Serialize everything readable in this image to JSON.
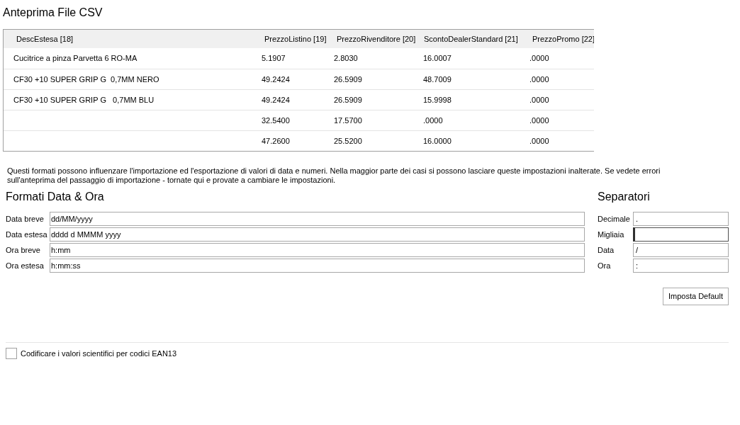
{
  "title": "Anteprima File CSV",
  "table": {
    "columns": [
      "DescEstesa [18]",
      "PrezzoListino [19]",
      "PrezzoRivenditore [20]",
      "ScontoDealerStandard [21]",
      "PrezzoPromo [22]"
    ],
    "rows": [
      [
        "Cucitrice a pinza Parvetta 6 RO-MA",
        "5.1907",
        "2.8030",
        "16.0007",
        ".0000"
      ],
      [
        "CF30 +10 SUPER GRIP G  0,7MM NERO",
        "49.2424",
        "26.5909",
        "48.7009",
        ".0000"
      ],
      [
        "CF30 +10 SUPER GRIP G   0,7MM BLU",
        "49.2424",
        "26.5909",
        "15.9998",
        ".0000"
      ],
      [
        "",
        "32.5400",
        "17.5700",
        ".0000",
        ".0000"
      ],
      [
        "",
        "47.2600",
        "25.5200",
        "16.0000",
        ".0000"
      ]
    ]
  },
  "info": "Questi formati possono influenzare l'importazione ed l'esportazione di valori di data e numeri. Nella maggior parte dei casi si possono lasciare queste impostazioni inalterate. Se vedete errori sull'anteprima del passaggio di importazione - tornate qui e provate a cambiare le impostazioni.",
  "date_formats": {
    "heading": "Formati Data & Ora",
    "fields": [
      {
        "label": "Data breve",
        "value": "dd/MM/yyyy"
      },
      {
        "label": "Data estesa",
        "value": "dddd d MMMM yyyy"
      },
      {
        "label": "Ora breve",
        "value": "h:mm"
      },
      {
        "label": "Ora estesa",
        "value": "h:mm:ss"
      }
    ]
  },
  "separators": {
    "heading": "Separatori",
    "fields": [
      {
        "label": "Decimale",
        "value": ".",
        "focused": false
      },
      {
        "label": "Migliaia",
        "focused": true
      },
      {
        "label": "Data",
        "value": "/",
        "focused": false
      },
      {
        "label": "Ora",
        "value": ":",
        "focused": false
      }
    ]
  },
  "default_button": "Imposta Default",
  "ean_checkbox": {
    "label": "Codificare i valori scientifici per codici EAN13",
    "checked": false
  }
}
